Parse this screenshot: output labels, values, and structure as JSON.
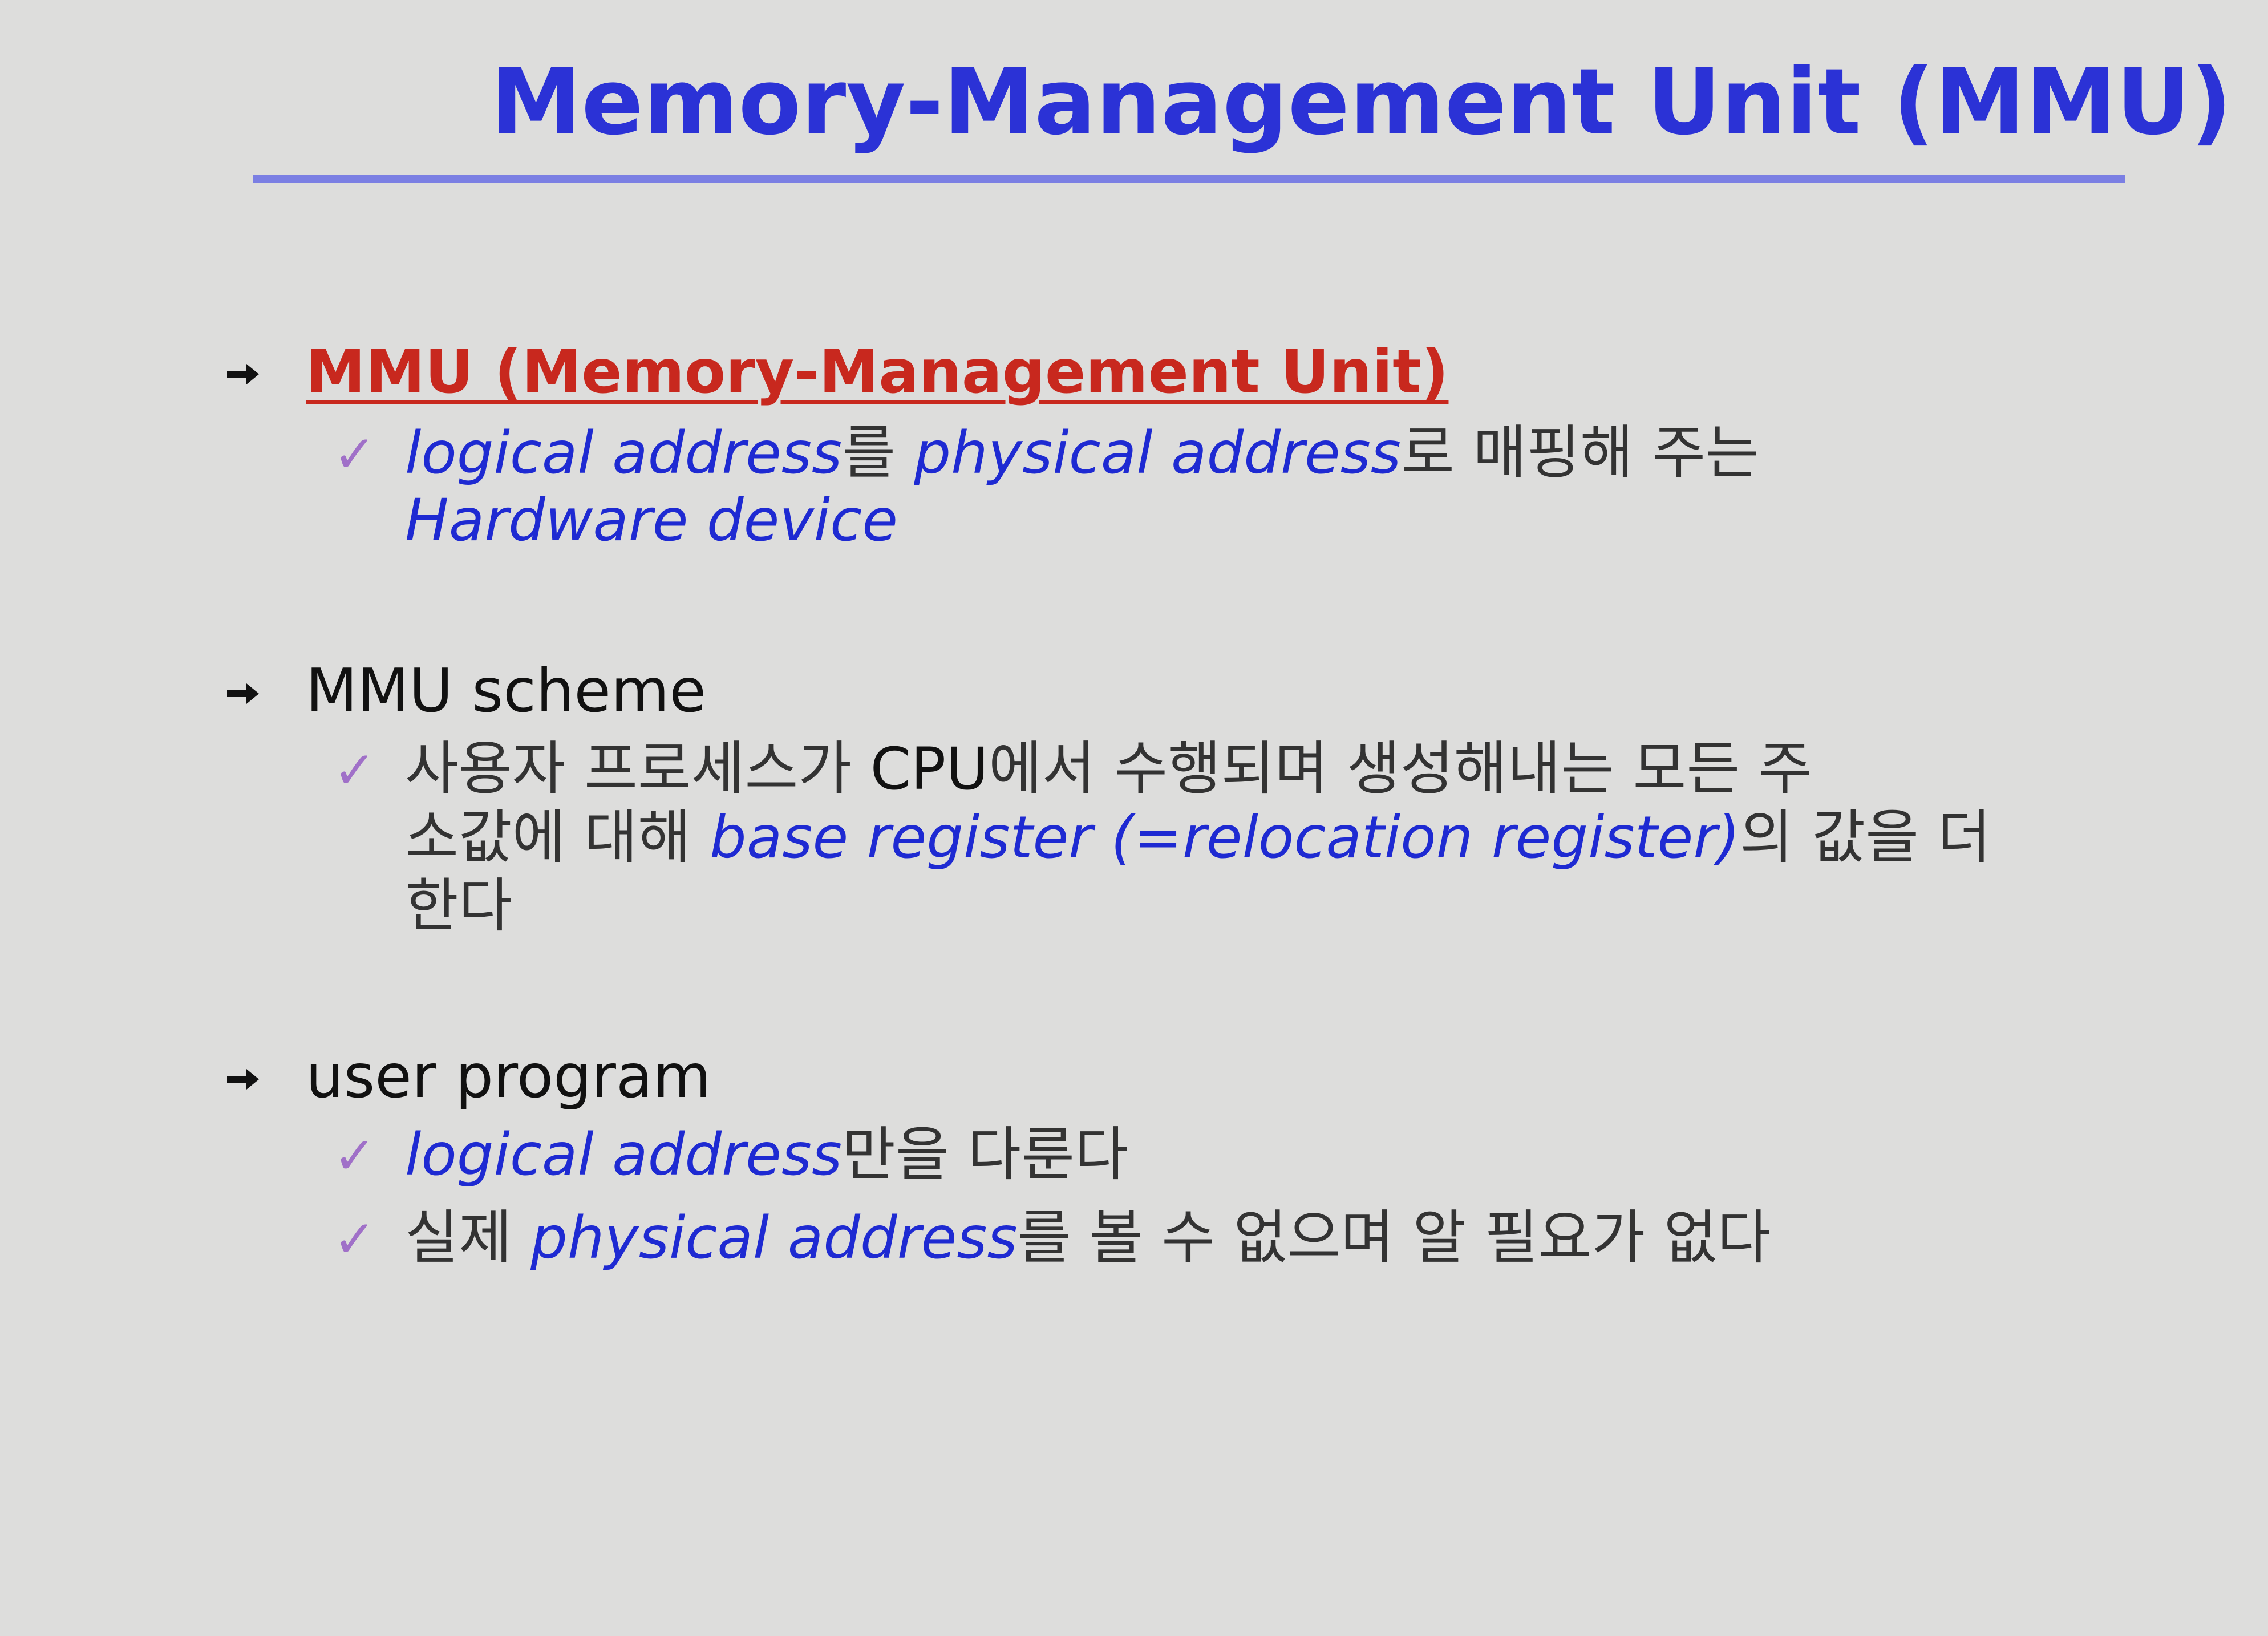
{
  "slide": {
    "title": "Memory-Management Unit (MMU)",
    "sections": [
      {
        "heading": "MMU (Memory-Management Unit)",
        "items": [
          {
            "line1": {
              "e1": "logical address",
              "t1": "를 ",
              "e2": "physical address",
              "t2": "로 매핑해 주는"
            },
            "line2": {
              "e1": "Hardware device"
            }
          }
        ]
      },
      {
        "heading": "MMU scheme",
        "items": [
          {
            "line1": {
              "t1": "사용자 프로세스가 ",
              "d1": "CPU",
              "t2": "에서 수행되며 생성해내는 모든 주"
            },
            "line2": {
              "t1": "소값에 대해 ",
              "e1": "base register (=relocation register)",
              "t2": "의 값을 더"
            },
            "line3": {
              "t1": "한다"
            }
          }
        ]
      },
      {
        "heading": "user program",
        "items": [
          {
            "e1": "logical address",
            "t1": "만을 다룬다"
          },
          {
            "t1": "실제 ",
            "e1": "physical address",
            "t2": "를 볼 수 없으며 알 필요가 없다"
          }
        ]
      }
    ]
  },
  "icons": {
    "bullet": "arrow-bullet-icon",
    "check": "checkmark-icon"
  },
  "colors": {
    "background": "#dddddc",
    "title": "#2b32d6",
    "emphasis": "#1e2ad2",
    "red_heading": "#c8281e",
    "check": "#a070c8"
  }
}
